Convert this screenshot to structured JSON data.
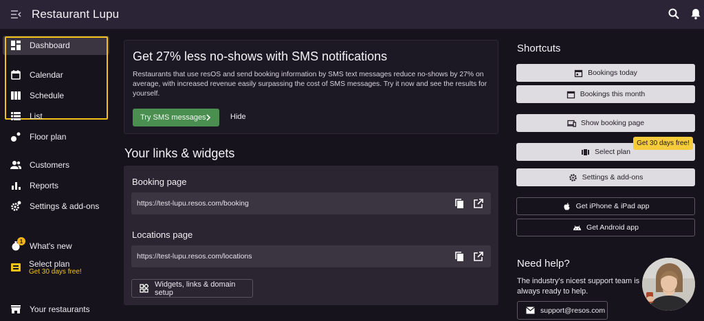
{
  "app": {
    "title": "Restaurant Lupu"
  },
  "sidebar": {
    "items": [
      {
        "id": "dashboard",
        "label": "Dashboard"
      },
      {
        "id": "calendar",
        "label": "Calendar"
      },
      {
        "id": "schedule",
        "label": "Schedule"
      },
      {
        "id": "list",
        "label": "List"
      },
      {
        "id": "floor-plan",
        "label": "Floor plan"
      },
      {
        "id": "customers",
        "label": "Customers"
      },
      {
        "id": "reports",
        "label": "Reports"
      },
      {
        "id": "settings",
        "label": "Settings & add-ons"
      },
      {
        "id": "whats-new",
        "label": "What's new",
        "badge": "1"
      },
      {
        "id": "your-restaurants",
        "label": "Your restaurants"
      }
    ],
    "select_plan": {
      "label": "Select plan",
      "sub": "Get 30 days free!"
    }
  },
  "sms": {
    "title": "Get 27% less no-shows with SMS notifications",
    "body": "Restaurants that use resOS and send booking information by SMS text messages reduce no-shows by 27% on average, with increased revenue easily surpassing the cost of SMS messages. Try it now and see the results for yourself.",
    "try_label": "Try SMS messages",
    "hide_label": "Hide"
  },
  "links": {
    "title": "Your links & widgets",
    "booking_label": "Booking page",
    "booking_url": "https://test-lupu.resos.com/booking",
    "locations_label": "Locations page",
    "locations_url": "https://test-lupu.resos.com/locations",
    "widgets_label": "Widgets, links & domain setup"
  },
  "shortcuts": {
    "title": "Shortcuts",
    "bookings_today": "Bookings today",
    "bookings_month": "Bookings this month",
    "show_booking_page": "Show booking page",
    "select_plan": "Select plan",
    "promo": "Get 30 days free!",
    "settings": "Settings & add-ons",
    "iphone": "Get iPhone & iPad app",
    "android": "Get Android app"
  },
  "help": {
    "title": "Need help?",
    "text": "The industry's nicest support team is always ready to help.",
    "email": "support@resos.com"
  },
  "colors": {
    "background": "#17131c",
    "topbar": "#2b2436",
    "accent_yellow": "#f2c21b",
    "button_green": "#4a8f4f"
  }
}
